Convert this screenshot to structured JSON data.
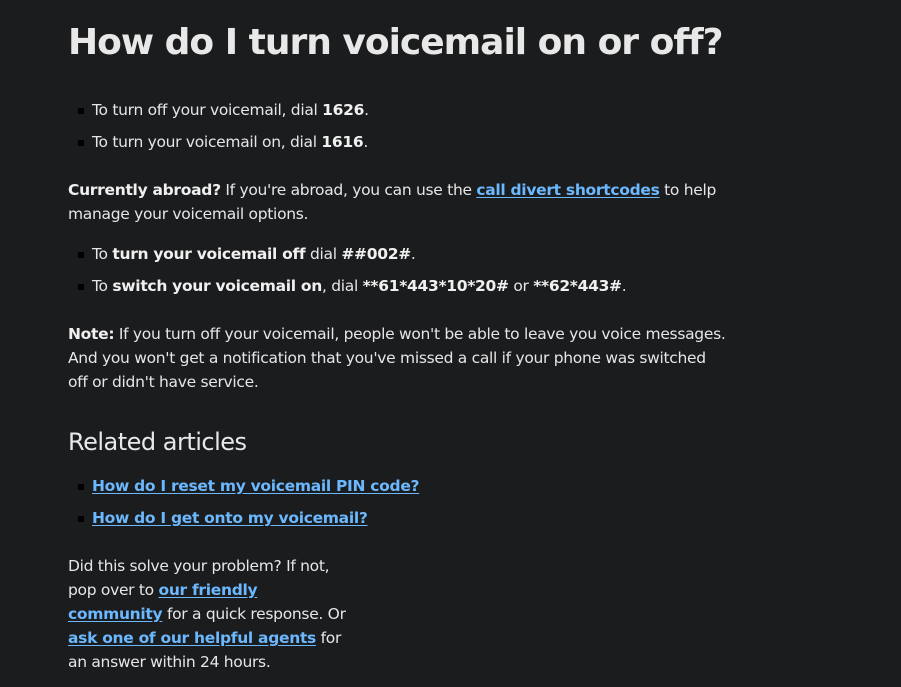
{
  "title": "How do I turn voicemail on or off?",
  "basic_list": [
    {
      "text": "To turn off your voicemail, dial ",
      "code": "1626",
      "end": "."
    },
    {
      "text": "To turn your voicemail on, dial ",
      "code": "1616",
      "end": "."
    }
  ],
  "abroad": {
    "lead": "Currently abroad?",
    "text1": " If you're abroad, you can use the ",
    "link": "call divert shortcodes",
    "text2": " to help manage your voicemail options."
  },
  "abroad_list": [
    {
      "pre": "To ",
      "bold": "turn your voicemail off",
      "mid": " dial ",
      "code": "##002#",
      "end": "."
    },
    {
      "pre": "To ",
      "bold": "switch your voicemail on",
      "mid": ", dial ",
      "code": "**61*443*10*20#",
      "or": " or ",
      "code2": "**62*443#",
      "end": "."
    }
  ],
  "note": {
    "lead": "Note:",
    "text": " If you turn off your voicemail, people won't be able to leave you voice messages. And you won't get a notification that you've missed a call if your phone was switched off or didn't have service."
  },
  "related": {
    "heading": "Related articles",
    "links": [
      "How do I reset my voicemail PIN code?",
      "How do I get onto my voicemail?"
    ]
  },
  "help": {
    "text1": "Did this solve your problem? If not, pop over to ",
    "link1": "our friendly community",
    "text2": " for a quick response. Or ",
    "link2": "ask one of our helpful agents",
    "text3": " for an answer within 24 hours."
  }
}
